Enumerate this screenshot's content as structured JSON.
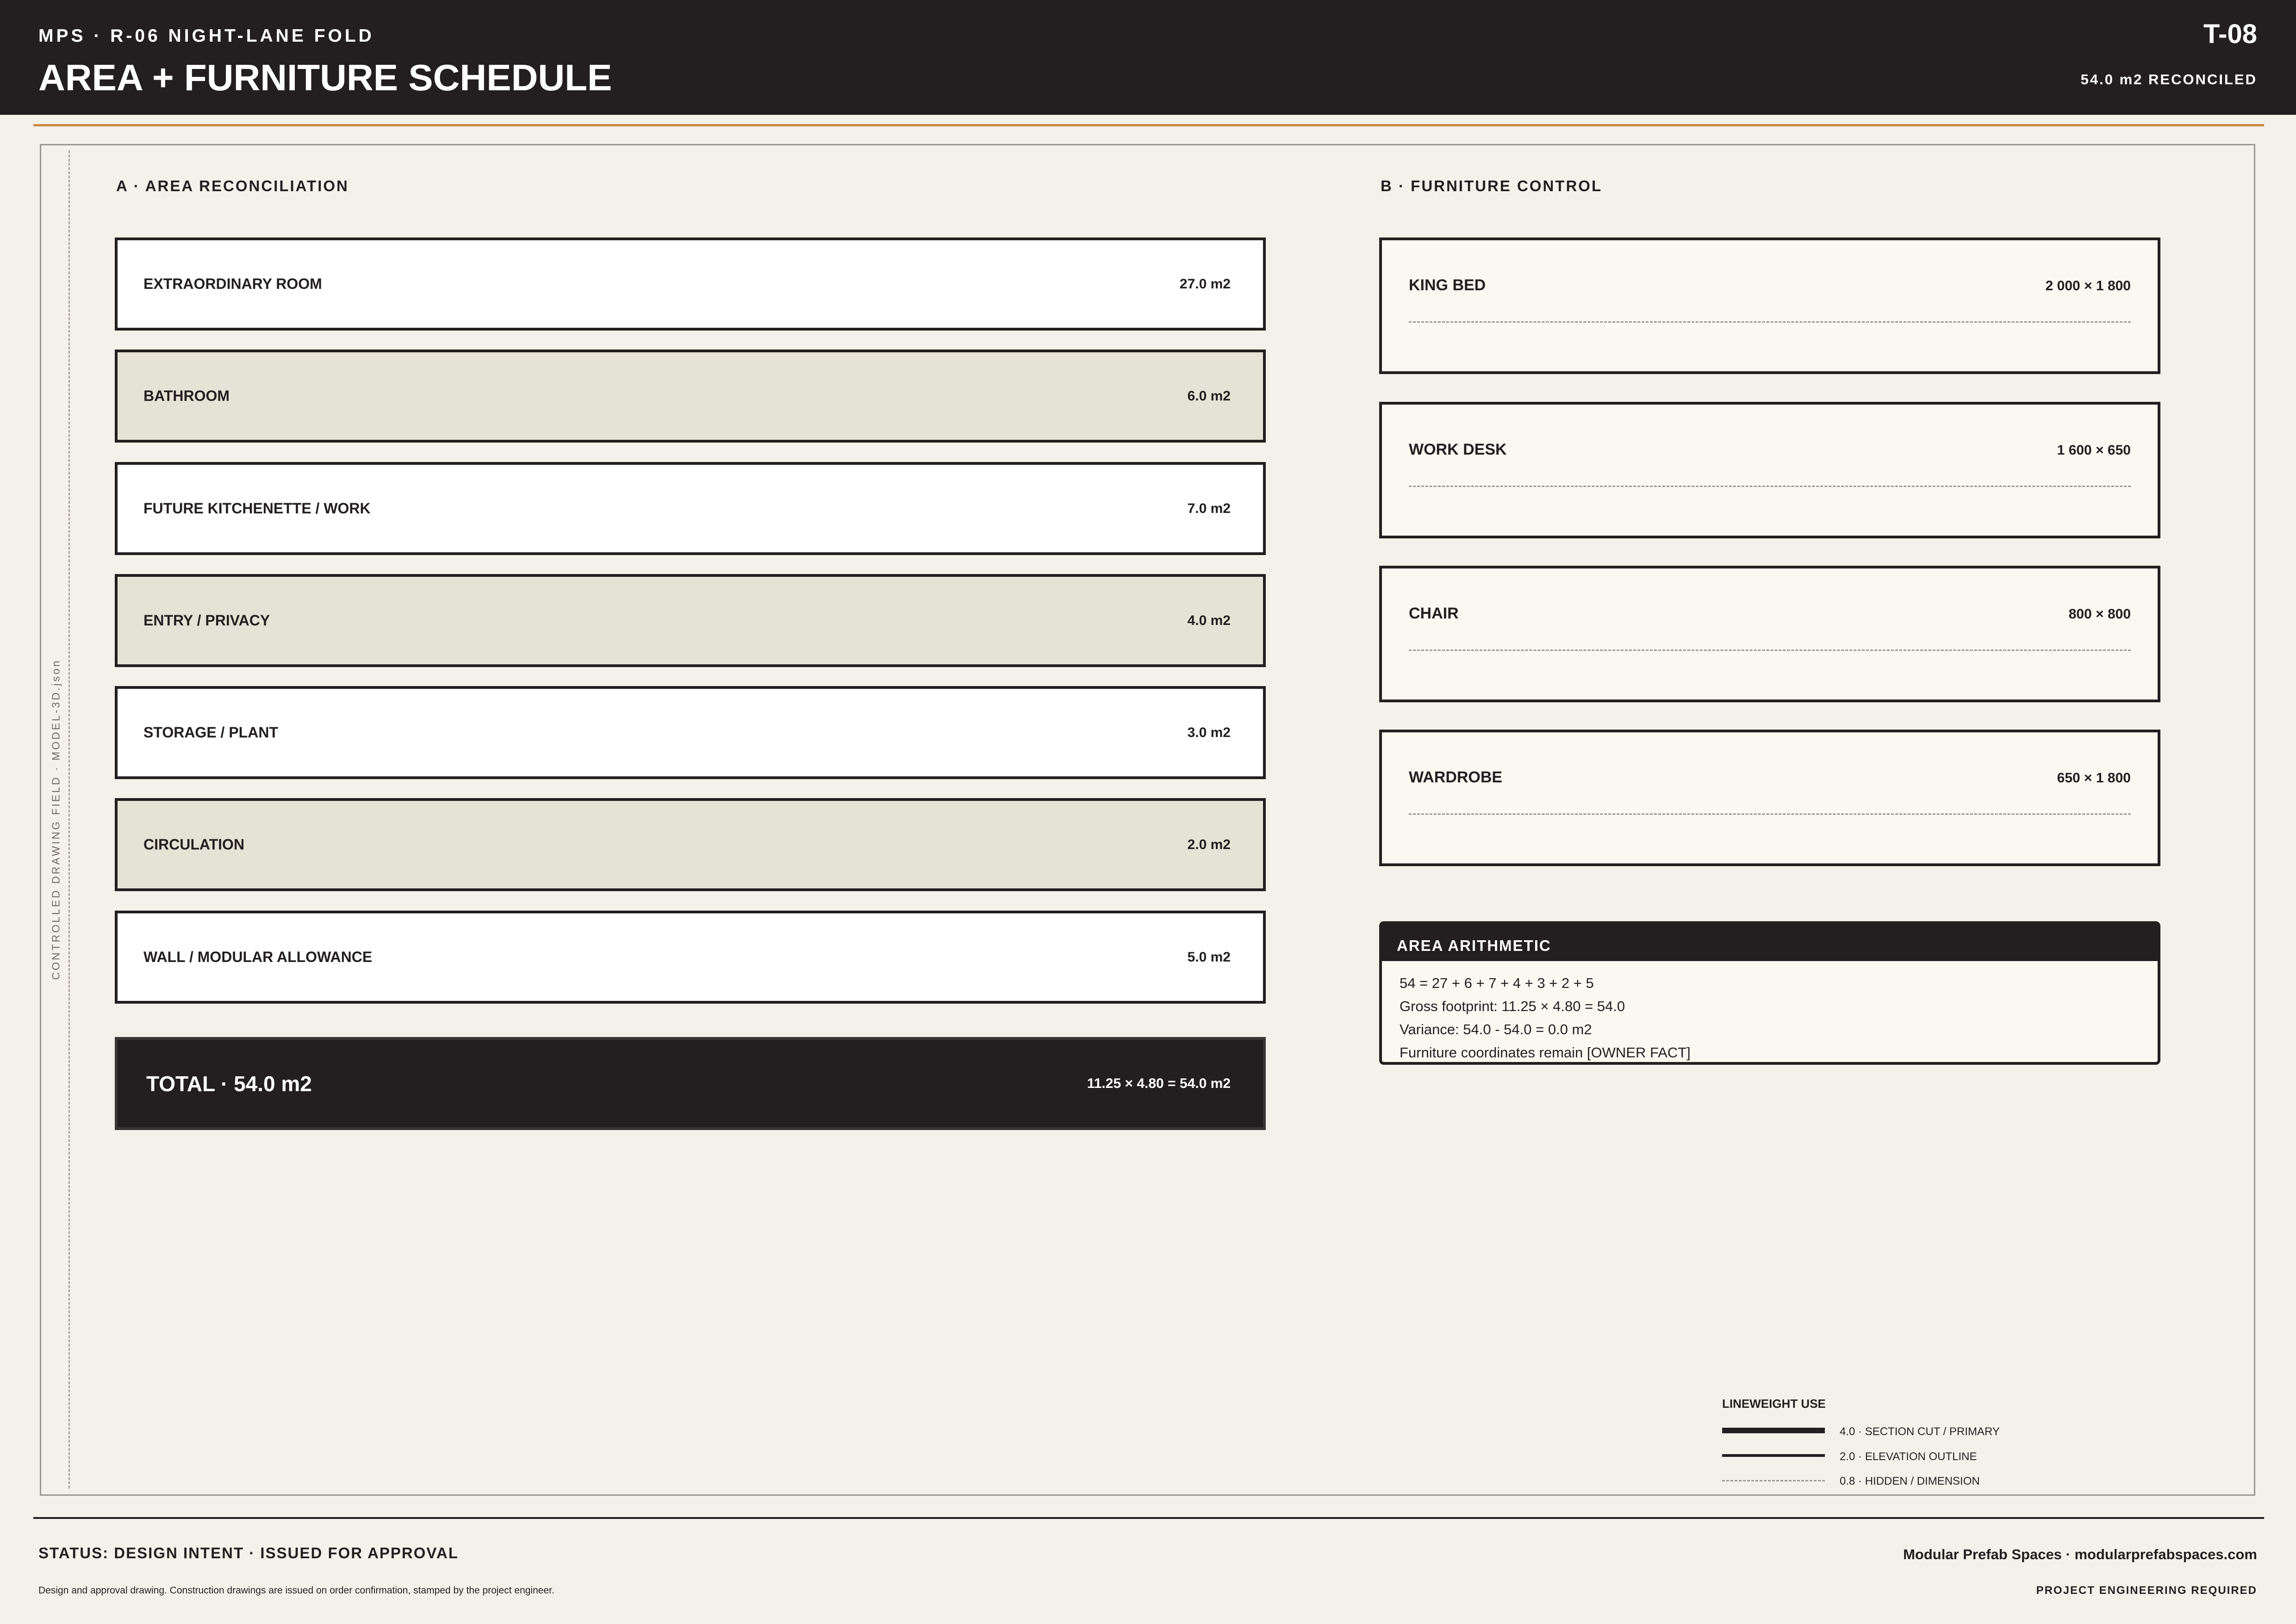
{
  "header": {
    "eyebrow": "MPS · R-06 NIGHT-LANE FOLD",
    "title": "AREA + FURNITURE SCHEDULE",
    "sheet_id": "T-08",
    "reconciled": "54.0 m2 RECONCILED"
  },
  "side_label": "CONTROLLED DRAWING FIELD · MODEL-3D.json",
  "area": {
    "title": "A · AREA RECONCILIATION",
    "rows": [
      {
        "label": "EXTRAORDINARY ROOM",
        "value": "27.0 m2"
      },
      {
        "label": "BATHROOM",
        "value": "6.0 m2"
      },
      {
        "label": "FUTURE KITCHENETTE / WORK",
        "value": "7.0 m2"
      },
      {
        "label": "ENTRY / PRIVACY",
        "value": "4.0 m2"
      },
      {
        "label": "STORAGE / PLANT",
        "value": "3.0 m2"
      },
      {
        "label": "CIRCULATION",
        "value": "2.0 m2"
      },
      {
        "label": "WALL / MODULAR ALLOWANCE",
        "value": "5.0 m2"
      }
    ],
    "total_label": "TOTAL · 54.0 m2",
    "total_value": "11.25 × 4.80 = 54.0 m2"
  },
  "furniture": {
    "title": "B · FURNITURE CONTROL",
    "items": [
      {
        "label": "KING BED",
        "value": "2 000 × 1 800"
      },
      {
        "label": "WORK DESK",
        "value": "1 600 × 650"
      },
      {
        "label": "CHAIR",
        "value": "800 × 800"
      },
      {
        "label": "WARDROBE",
        "value": "650 × 1 800"
      }
    ]
  },
  "arithmetic": {
    "title": "AREA ARITHMETIC",
    "lines": [
      "54 = 27 + 6 + 7 + 4 + 3 + 2 + 5",
      "Gross footprint: 11.25 × 4.80 = 54.0",
      "Variance: 54.0 - 54.0 = 0.0 m2",
      "Furniture coordinates remain [OWNER FACT]"
    ]
  },
  "legend": {
    "title": "LINEWEIGHT USE",
    "items": [
      "4.0 · SECTION CUT / PRIMARY",
      "2.0 · ELEVATION OUTLINE",
      "0.8 · HIDDEN / DIMENSION"
    ]
  },
  "footer": {
    "status": "STATUS: DESIGN INTENT · ISSUED FOR APPROVAL",
    "disclaimer": "Design and approval drawing. Construction drawings are issued on order confirmation, stamped by the project engineer.",
    "company": "Modular Prefab Spaces · modularprefabspaces.com",
    "engineering": "PROJECT ENGINEERING REQUIRED"
  },
  "colors": {
    "ink": "#231f20",
    "paper": "#f4f1ea",
    "accent": "#c98b43",
    "row_tint": "#e5e2d6"
  }
}
